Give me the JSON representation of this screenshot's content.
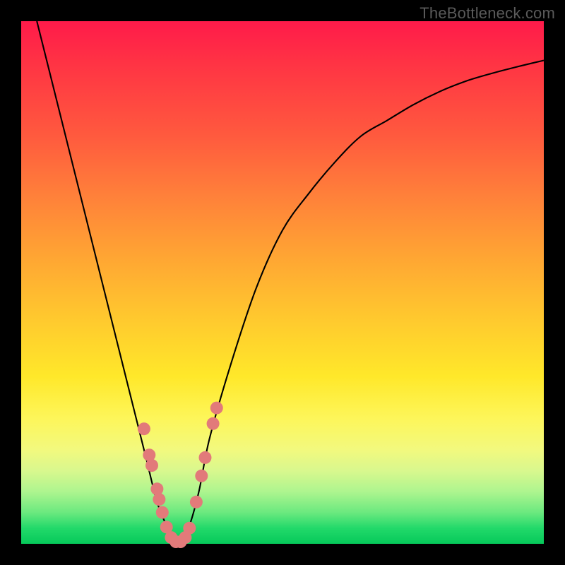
{
  "watermark": "TheBottleneck.com",
  "chart_data": {
    "type": "line",
    "title": "",
    "xlabel": "",
    "ylabel": "",
    "xlim": [
      0,
      100
    ],
    "ylim": [
      0,
      100
    ],
    "series": [
      {
        "name": "bottleneck-curve",
        "x": [
          3,
          6,
          9,
          12,
          15,
          18,
          20,
          22,
          24,
          26,
          28,
          29,
          30,
          32,
          34,
          36,
          40,
          45,
          50,
          55,
          60,
          65,
          70,
          75,
          80,
          85,
          90,
          95,
          100
        ],
        "y": [
          100,
          88,
          76,
          64,
          52,
          40,
          32,
          24,
          16,
          8,
          3,
          0.5,
          0,
          3,
          10,
          20,
          34,
          49,
          60,
          67,
          73,
          78,
          81,
          84,
          86.5,
          88.5,
          90,
          91.3,
          92.5
        ]
      }
    ],
    "markers": {
      "name": "highlight-dots",
      "points": [
        {
          "x": 23.5,
          "y": 22
        },
        {
          "x": 24.5,
          "y": 17
        },
        {
          "x": 25.0,
          "y": 15
        },
        {
          "x": 26.0,
          "y": 10.5
        },
        {
          "x": 26.4,
          "y": 8.5
        },
        {
          "x": 27.0,
          "y": 6
        },
        {
          "x": 27.8,
          "y": 3.2
        },
        {
          "x": 28.7,
          "y": 1.2
        },
        {
          "x": 29.6,
          "y": 0.4
        },
        {
          "x": 30.5,
          "y": 0.4
        },
        {
          "x": 31.4,
          "y": 1.2
        },
        {
          "x": 32.2,
          "y": 3
        },
        {
          "x": 33.5,
          "y": 8
        },
        {
          "x": 34.5,
          "y": 13
        },
        {
          "x": 35.2,
          "y": 16.5
        },
        {
          "x": 36.7,
          "y": 23
        },
        {
          "x": 37.4,
          "y": 26
        }
      ]
    },
    "marker_style": {
      "color": "#e27a7a",
      "radius": 9
    },
    "curve_style": {
      "color": "#000000",
      "width": 2.1
    }
  }
}
